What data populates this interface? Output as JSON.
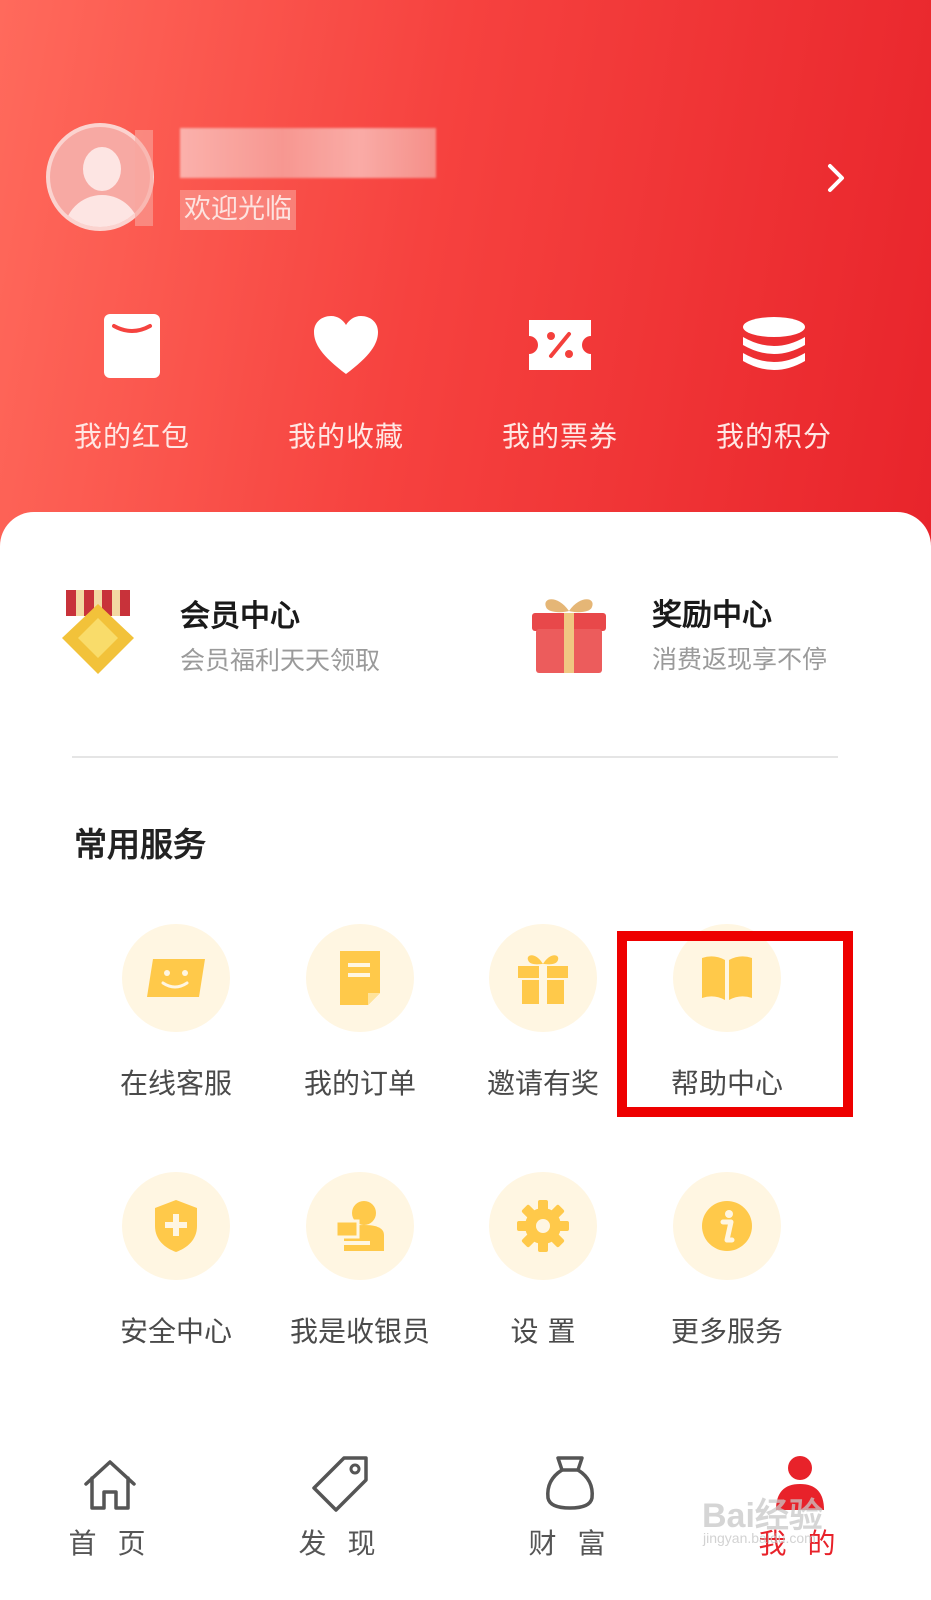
{
  "profile": {
    "welcome": "欢迎光临"
  },
  "quick_actions": [
    {
      "label": "我的红包",
      "icon": "red-packet-icon"
    },
    {
      "label": "我的收藏",
      "icon": "heart-icon"
    },
    {
      "label": "我的票券",
      "icon": "coupon-icon"
    },
    {
      "label": "我的积分",
      "icon": "points-stack-icon"
    }
  ],
  "promos": [
    {
      "title": "会员中心",
      "subtitle": "会员福利天天领取",
      "icon": "medal-icon"
    },
    {
      "title": "奖励中心",
      "subtitle": "消费返现享不停",
      "icon": "gift-box-icon"
    }
  ],
  "services": {
    "title": "常用服务",
    "items": [
      {
        "label": "在线客服",
        "icon": "smile-chat-icon"
      },
      {
        "label": "我的订单",
        "icon": "document-icon"
      },
      {
        "label": "邀请有奖",
        "icon": "gift-icon"
      },
      {
        "label": "帮助中心",
        "icon": "open-book-icon",
        "highlighted": true
      },
      {
        "label": "安全中心",
        "icon": "shield-plus-icon"
      },
      {
        "label": "我是收银员",
        "icon": "cashier-icon"
      },
      {
        "label": "设 置",
        "icon": "gear-icon"
      },
      {
        "label": "更多服务",
        "icon": "info-icon"
      }
    ]
  },
  "tabbar": [
    {
      "label": "首 页",
      "icon": "home-icon"
    },
    {
      "label": "发 现",
      "icon": "tag-icon"
    },
    {
      "label": "财 富",
      "icon": "money-bag-icon"
    },
    {
      "label": "我 的",
      "icon": "user-icon",
      "active": true
    }
  ],
  "watermark": {
    "brand": "Bai经验",
    "url": "jingyan.baidu.com"
  },
  "colors": {
    "header_start": "#ff6a5c",
    "header_end": "#e8242b",
    "service_icon": "#ffc94a",
    "service_circle": "#fff6e2",
    "highlight_box": "#ee0000",
    "active_tab": "#e8222a"
  }
}
